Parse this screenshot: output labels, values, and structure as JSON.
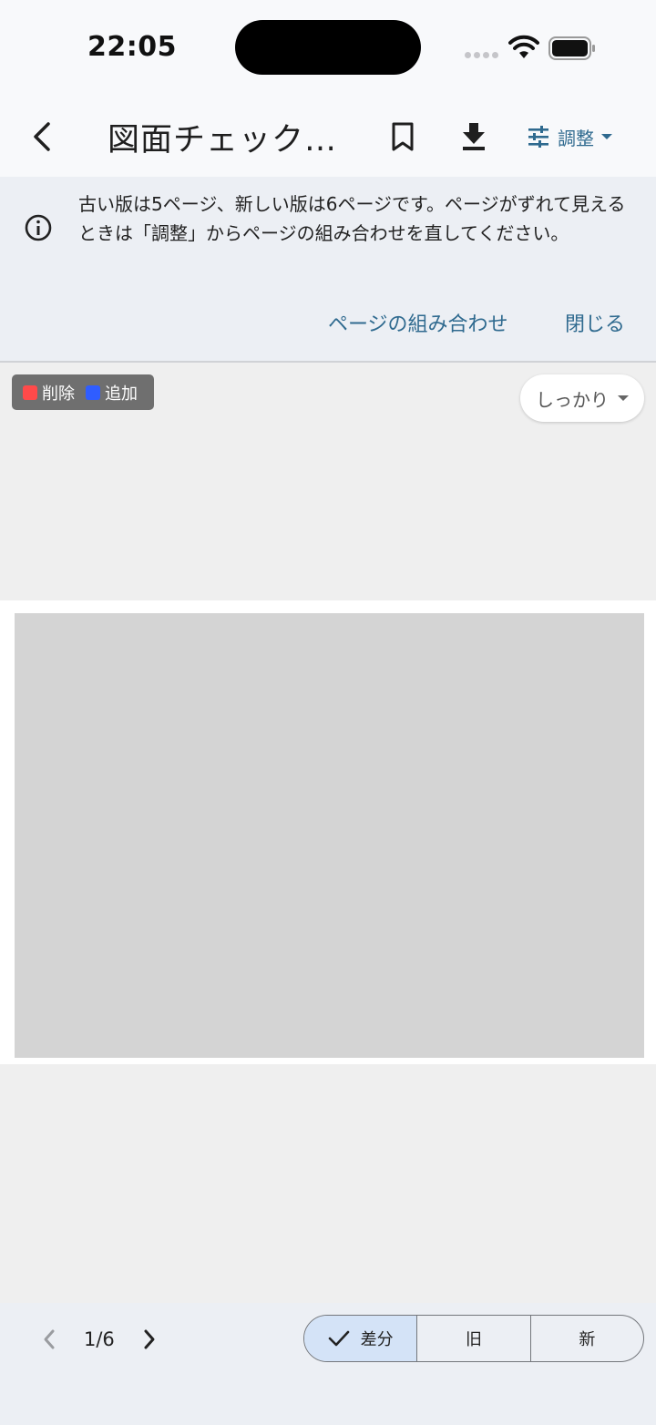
{
  "status_bar": {
    "time": "22:05"
  },
  "app_bar": {
    "title": "図面チェック…",
    "adjust_label": "調整",
    "icons": {
      "back": "chevron-left-icon",
      "bookmark": "bookmark-icon",
      "download": "download-icon",
      "adjust": "tune-icon"
    }
  },
  "banner": {
    "message": "古い版は5ページ、新しい版は6ページです。ページがずれて見えるときは「調整」からページの組み合わせを直してください。",
    "actions": {
      "pages": "ページの組み合わせ",
      "close": "閉じる"
    }
  },
  "legend": {
    "items": [
      {
        "label": "削除",
        "color": "#ff4a4a"
      },
      {
        "label": "追加",
        "color": "#2f5dff"
      }
    ]
  },
  "strength_dropdown": {
    "value": "しっかり"
  },
  "pager": {
    "current": "1/6"
  },
  "view_mode": {
    "options": [
      {
        "label": "差分",
        "selected": true
      },
      {
        "label": "旧",
        "selected": false
      },
      {
        "label": "新",
        "selected": false
      }
    ]
  },
  "colors": {
    "accent": "#2f6a8f",
    "selected_segment": "#d4e3f7",
    "banner_bg": "#eceff4"
  }
}
